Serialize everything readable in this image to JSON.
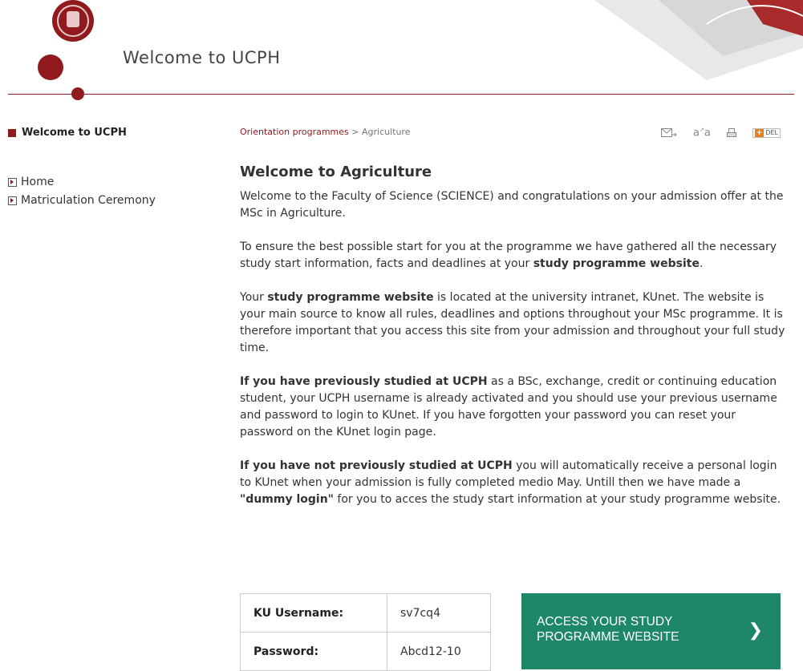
{
  "header": {
    "title": "Welcome to UCPH"
  },
  "sidebar": {
    "title": "Welcome to UCPH",
    "items": [
      {
        "label": "Home"
      },
      {
        "label": "Matriculation Ceremony"
      }
    ]
  },
  "breadcrumb": {
    "parent": "Orientation programmes",
    "separator": " > ",
    "current": "Agriculture"
  },
  "tools": {
    "email_icon": "email-forward-icon",
    "text_size_icon": "text-size-icon",
    "print_icon": "print-icon",
    "share_label": "DEL"
  },
  "main": {
    "heading": "Welcome to Agriculture",
    "p1": "Welcome to the Faculty of Science (SCIENCE) and congratulations on your admission offer at the MSc in Agriculture.",
    "p2_a": "To ensure the best possible start for you at the programme we have gathered all the necessary study start information, facts and deadlines at your ",
    "p2_b": "study programme website",
    "p2_c": ".",
    "p3_a": "Your ",
    "p3_b": "study programme website",
    "p3_c": " is located at the university intranet, KUnet. The website is your main source to know all rules, deadlines and options throughout your MSc programme. It is therefore important that you access this site from your admission and throughout your full study time.",
    "p4_a": "If you have previously studied at UCPH",
    "p4_b": " as a BSc, exchange, credit or continuing education student, your UCPH username is already activated and you should use your previous username and password to login to KUnet. If you have forgotten your password you can reset your password on the KUnet login page.",
    "p5_a": "If you have not previously studied at UCPH",
    "p5_b": " you will automatically receive a personal login to KUnet when your admission is fully completed medio May. Untill then we have made a ",
    "p5_c": "\"dummy login\"",
    "p5_d": " for you to acces the study start information at your study programme website."
  },
  "credentials": {
    "username_label": "KU Username:",
    "username_value": "sv7cq4",
    "password_label": "Password:",
    "password_value": "Abcd12-10"
  },
  "cta": {
    "line1": "ACCESS YOUR STUDY",
    "line2": "PROGRAMME WEBSITE",
    "arrow": "❯"
  },
  "colors": {
    "brand": "#901a1e",
    "cta": "#1f8769"
  }
}
